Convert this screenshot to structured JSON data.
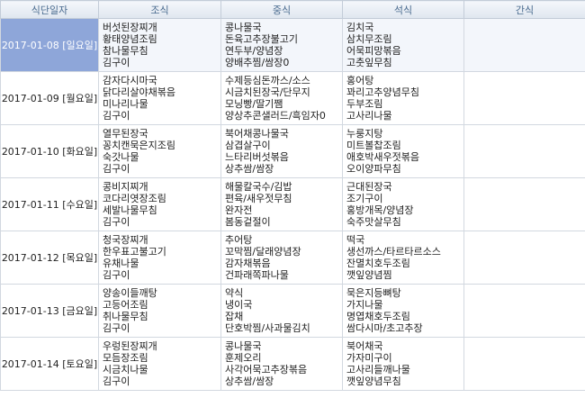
{
  "columns": [
    "식단일자",
    "조식",
    "중식",
    "석식",
    "간식"
  ],
  "rows": [
    {
      "date": "2017-01-08 [일요일]",
      "breakfast": [
        "버섯된장찌개",
        "황태양념조림",
        "참나물무침",
        "김구이"
      ],
      "lunch": [
        "콩나물국",
        "돈육고추장불고기",
        "연두부/양념장",
        "양배추찜/쌈장0"
      ],
      "dinner": [
        "김치국",
        "삼치무조림",
        "어묵피망볶음",
        "고춧잎무침"
      ],
      "snack": []
    },
    {
      "date": "2017-01-09 [월요일]",
      "breakfast": [
        "감자다시마국",
        "닭다리살야채볶음",
        "미나리나물",
        "김구이"
      ],
      "lunch": [
        "수제등심돈까스/소스",
        "시금치된장국/단무지",
        "모닝빵/딸기쨈",
        "양상추콘샐러드/흑임자0"
      ],
      "dinner": [
        "홍어탕",
        "꽈리고추양념무침",
        "두부조림",
        "고사리나물"
      ],
      "snack": []
    },
    {
      "date": "2017-01-10 [화요일]",
      "breakfast": [
        "열무된장국",
        "꽁치캔묵은지조림",
        "숙갓나물",
        "김구이"
      ],
      "lunch": [
        "북어채콩나물국",
        "삼겹살구이",
        "느타리버섯볶음",
        "상추쌈/쌈장"
      ],
      "dinner": [
        "누룽지탕",
        "미트볼찹조림",
        "애호박새우젓볶음",
        "오이양파무침"
      ],
      "snack": []
    },
    {
      "date": "2017-01-11 [수요일]",
      "breakfast": [
        "콩비지찌개",
        "코다리엿장조림",
        "세발나물무침",
        "김구이"
      ],
      "lunch": [
        "해물칼국수/김밥",
        "편육/새우젓무침",
        "완자전",
        "봄동겉절이"
      ],
      "dinner": [
        "근대된장국",
        "조기구이",
        "홍방개목/양념장",
        "숙주맛살무침"
      ],
      "snack": []
    },
    {
      "date": "2017-01-12 [목요일]",
      "breakfast": [
        "청국장찌개",
        "한우표고불고기",
        "유채나물",
        "김구이"
      ],
      "lunch": [
        "추어탕",
        "꼬막찜/달래양념장",
        "감자채볶음",
        "건파래쪽파나물"
      ],
      "dinner": [
        "떡국",
        "생선까스/타르타르소스",
        "잔멸치호두조림",
        "깻잎양념찜"
      ],
      "snack": []
    },
    {
      "date": "2017-01-13 [금요일]",
      "breakfast": [
        "양송이들깨탕",
        "고등어조림",
        "취나물무침",
        "김구이"
      ],
      "lunch": [
        "약식",
        "냉이국",
        "잡채",
        "단호박찜/사과물김치"
      ],
      "dinner": [
        "묵은지등뼈탕",
        "가지나물",
        "명엽채호두조림",
        "쌈다시마/초고추장"
      ],
      "snack": []
    },
    {
      "date": "2017-01-14 [토요일]",
      "breakfast": [
        "우렁된장찌개",
        "모듬장조림",
        "시금치나물",
        "김구이"
      ],
      "lunch": [
        "콩나물국",
        "훈제오리",
        "사각어묵고추장볶음",
        "상추쌈/쌈장"
      ],
      "dinner": [
        "북어채국",
        "가자미구이",
        "고사리들깨나물",
        "깻잎양념무침"
      ],
      "snack": []
    }
  ]
}
